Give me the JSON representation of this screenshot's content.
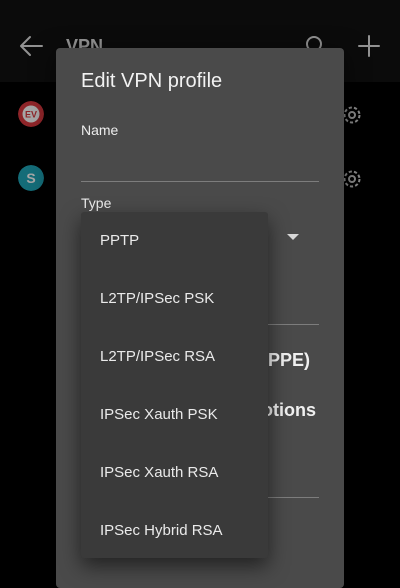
{
  "appbar": {
    "title": "VPN",
    "icons": [
      "back-arrow-icon",
      "search-icon",
      "add-icon"
    ]
  },
  "vpn_list": [
    {
      "icon": "expressvpn-app-icon",
      "icon_label": "EV",
      "color": "#da3940",
      "action_icon": "gear-icon"
    },
    {
      "icon": "surfshark-app-icon",
      "icon_label": "S",
      "color": "#1fa6b8",
      "action_icon": "gear-icon"
    }
  ],
  "dialog": {
    "title": "Edit VPN profile",
    "name_label": "Name",
    "name_value": "",
    "type_label": "Type",
    "partial_text_1": "PPE)",
    "partial_text_2": "otions"
  },
  "type_menu": {
    "options": [
      "PPTP",
      "L2TP/IPSec PSK",
      "L2TP/IPSec RSA",
      "IPSec Xauth PSK",
      "IPSec Xauth RSA",
      "IPSec Hybrid RSA"
    ]
  },
  "colors": {
    "background": "#000000",
    "appbar": "#111111",
    "dialog": "#4a4a4a",
    "menu": "#3a3a3a",
    "text": "#eaeaea"
  }
}
